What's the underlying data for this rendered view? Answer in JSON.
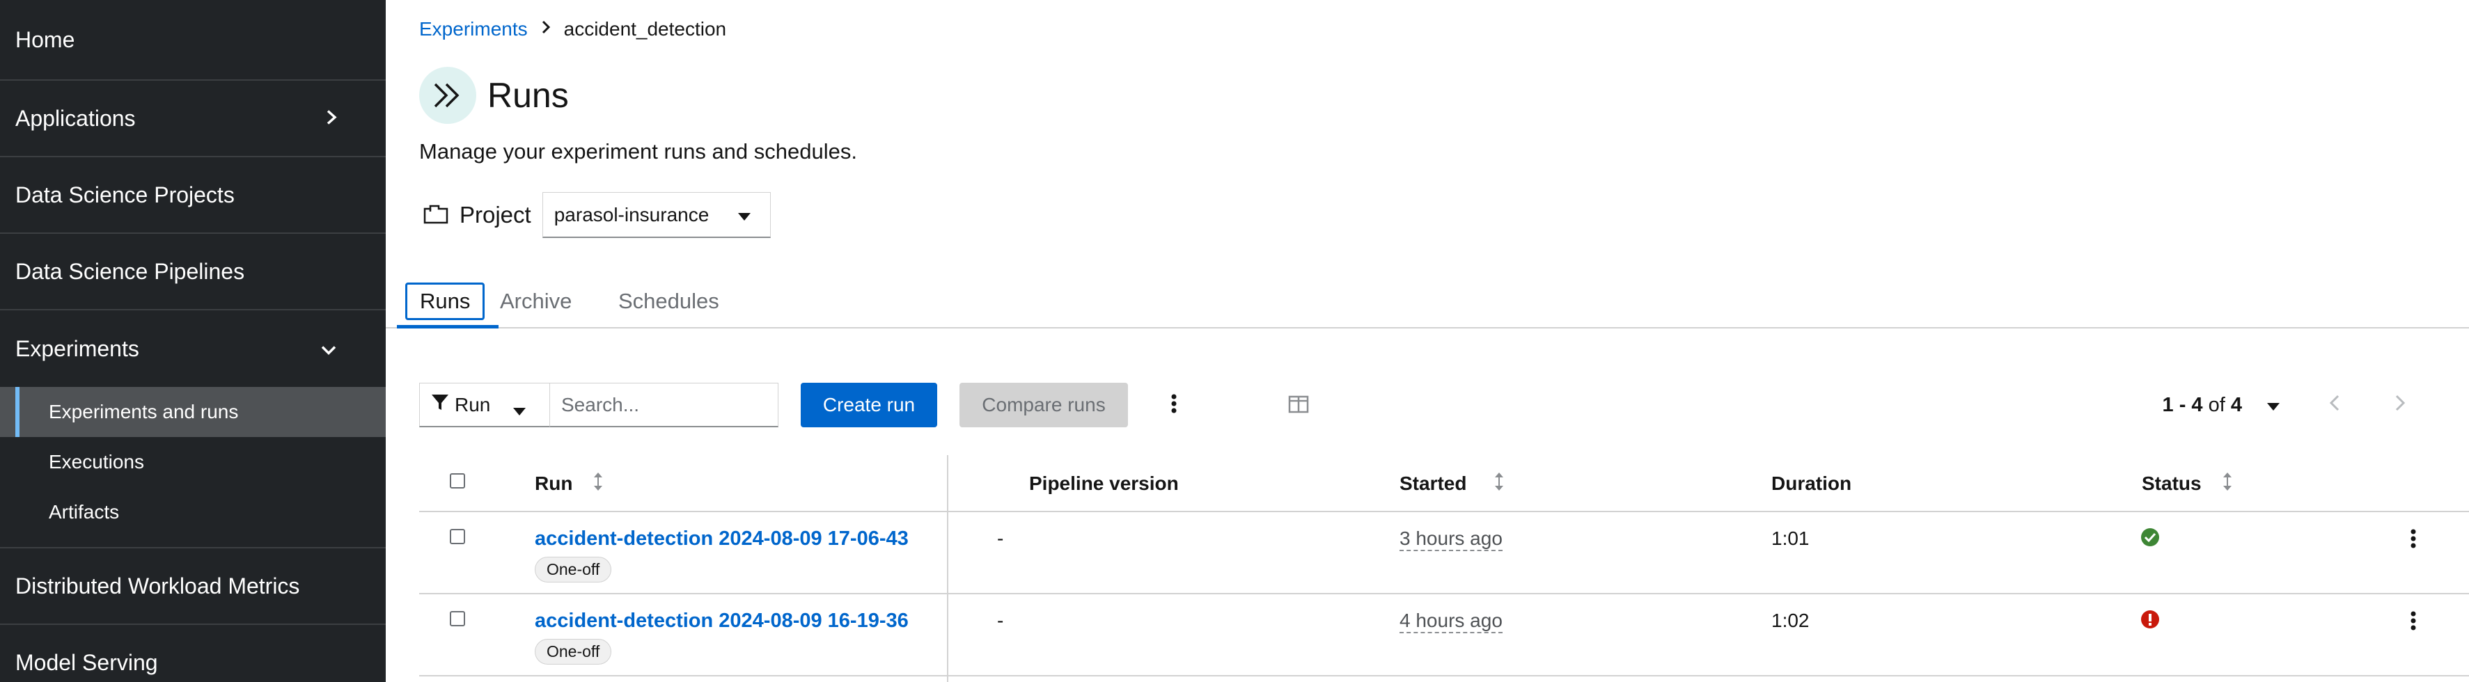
{
  "sidebar": {
    "items": [
      {
        "label": "Home"
      },
      {
        "label": "Applications",
        "icon": "chevron-right-icon"
      },
      {
        "label": "Data Science Projects"
      },
      {
        "label": "Data Science Pipelines"
      },
      {
        "label": "Experiments",
        "icon": "chevron-down-icon"
      },
      {
        "label": "Distributed Workload Metrics"
      },
      {
        "label": "Model Serving"
      }
    ],
    "experiments_subitems": [
      {
        "label": "Experiments and runs",
        "active": true
      },
      {
        "label": "Executions"
      },
      {
        "label": "Artifacts"
      }
    ]
  },
  "breadcrumb": {
    "parent": "Experiments",
    "current": "accident_detection"
  },
  "page": {
    "title": "Runs",
    "description": "Manage your experiment runs and schedules.",
    "project_label": "Project",
    "project_value": "parasol-insurance"
  },
  "tabs": [
    {
      "label": "Runs",
      "active": true
    },
    {
      "label": "Archive"
    },
    {
      "label": "Schedules"
    }
  ],
  "toolbar": {
    "filter_label": "Run",
    "search_placeholder": "Search...",
    "create_run": "Create run",
    "compare_runs": "Compare runs",
    "pagination_range": "1 - 4",
    "pagination_of": "of",
    "pagination_total": "4"
  },
  "table": {
    "columns": [
      "Run",
      "Pipeline version",
      "Started",
      "Duration",
      "Status"
    ],
    "rows": [
      {
        "run": "accident-detection 2024-08-09 17-06-43",
        "badge": "One-off",
        "pipeline_version": "-",
        "started": "3 hours ago",
        "duration": "1:01",
        "status": "success"
      },
      {
        "run": "accident-detection 2024-08-09 16-19-36",
        "badge": "One-off",
        "pipeline_version": "-",
        "started": "4 hours ago",
        "duration": "1:02",
        "status": "error"
      }
    ]
  },
  "colors": {
    "accent": "#0066cc",
    "sidebar_bg": "#212427",
    "success": "#3e8635",
    "danger": "#c9190b"
  }
}
